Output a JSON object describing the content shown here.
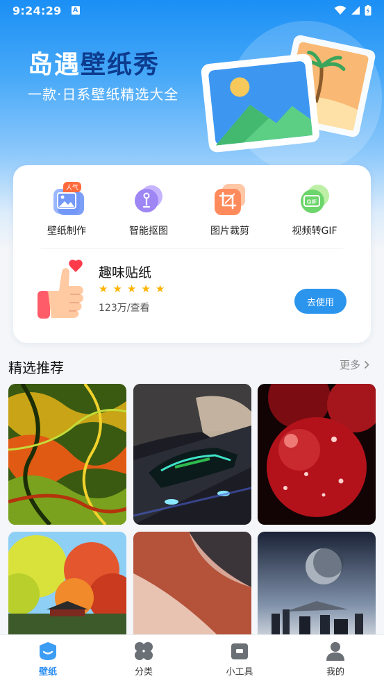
{
  "status_bar": {
    "time": "9:24:29",
    "notification_glyph": "A"
  },
  "hero": {
    "title_part1": "岛遇",
    "title_part2": "壁纸秀",
    "subtitle": "一款·日系壁纸精选大全"
  },
  "tools": [
    {
      "label": "壁纸制作",
      "badge": "人气",
      "icon": "image-icon"
    },
    {
      "label": "智能抠图",
      "icon": "cutout-icon"
    },
    {
      "label": "图片裁剪",
      "icon": "crop-icon"
    },
    {
      "label": "视频转GIF",
      "icon": "gif-icon",
      "icon_text": "GIF"
    }
  ],
  "sticker": {
    "title": "趣味贴纸",
    "rating": 5,
    "views": "123万/查看",
    "button": "去使用"
  },
  "featured": {
    "title": "精选推荐",
    "more": "更多"
  },
  "gallery": [
    {
      "subject": "abstract-swirl"
    },
    {
      "subject": "race-car"
    },
    {
      "subject": "cherries"
    },
    {
      "subject": "autumn-trees"
    },
    {
      "subject": "desert-dune"
    },
    {
      "subject": "city-moon"
    }
  ],
  "bottom_nav": [
    {
      "label": "壁纸",
      "icon": "wallpaper-icon",
      "active": true
    },
    {
      "label": "分类",
      "icon": "category-icon",
      "active": false
    },
    {
      "label": "小工具",
      "icon": "toolbox-icon",
      "active": false
    },
    {
      "label": "我的",
      "icon": "profile-icon",
      "active": false
    }
  ],
  "colors": {
    "accent": "#2b8ef3",
    "star": "#ffb400"
  }
}
